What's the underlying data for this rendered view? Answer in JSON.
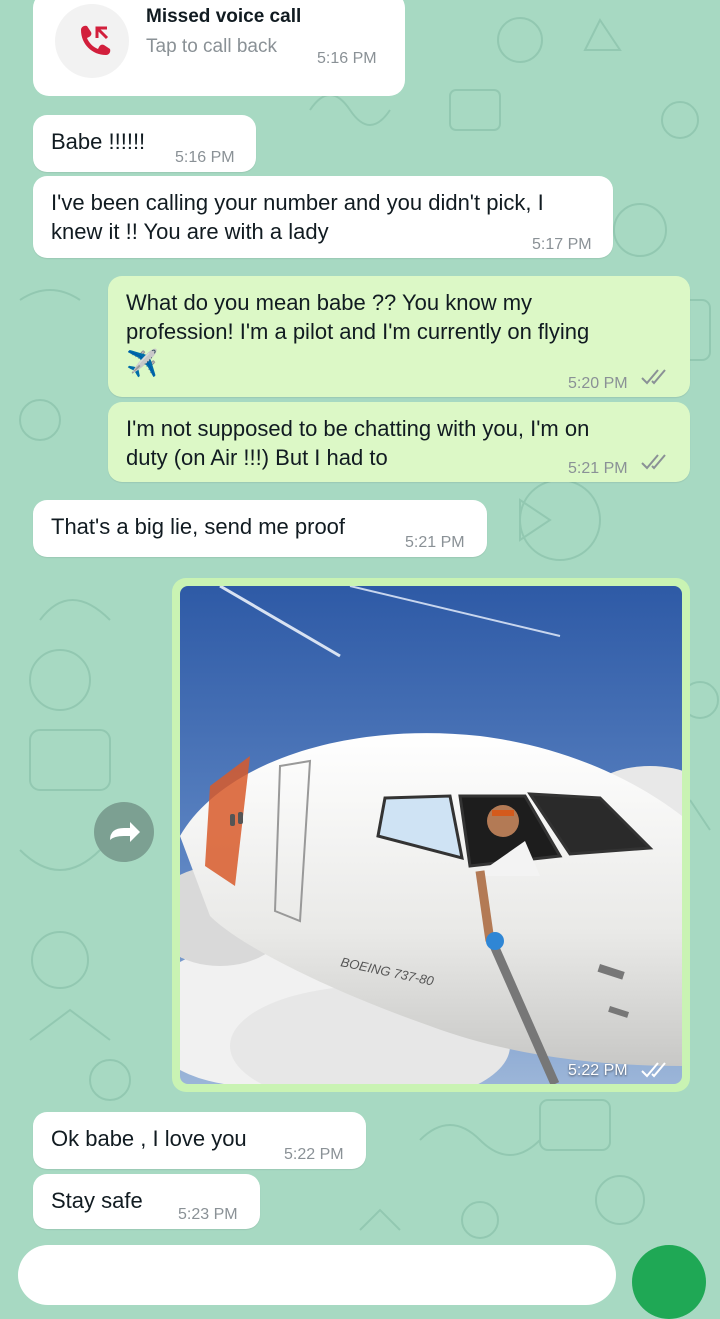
{
  "colors": {
    "wallpaper": "#a7d9c2",
    "incoming_bubble": "#ffffff",
    "outgoing_bubble": "#dcf8c6",
    "missed_call_red": "#d21f3c",
    "send_button": "#1fa855"
  },
  "missed_call": {
    "title": "Missed voice call",
    "subtitle": "Tap to call back",
    "time": "5:16 PM",
    "icon": "missed-call-icon"
  },
  "messages": [
    {
      "direction": "in",
      "text": "Babe !!!!!!",
      "time": "5:16 PM"
    },
    {
      "direction": "in",
      "text_line1": "I've been calling your number and you didn't pick,  I",
      "text_line2": "knew it !! You are with a lady",
      "time": "5:17 PM"
    },
    {
      "direction": "out",
      "text_line1": "What do you mean babe ?? You know my",
      "text_line2": "profession! I'm a pilot and I'm currently on flying",
      "emoji": "✈️",
      "time": "5:20 PM",
      "status": "read"
    },
    {
      "direction": "out",
      "text_line1": "I'm not supposed to be chatting with you,  I'm on",
      "text_line2": "duty (on Air !!!) But I had to",
      "time": "5:21 PM",
      "status": "read"
    },
    {
      "direction": "in",
      "text": "That's a big lie,  send me proof",
      "time": "5:21 PM"
    },
    {
      "direction": "out",
      "type": "image",
      "image_text": "BOEING 737-80",
      "time": "5:22 PM",
      "status": "read"
    },
    {
      "direction": "in",
      "text": "Ok babe , I love you",
      "time": "5:22 PM"
    },
    {
      "direction": "in",
      "text": "Stay safe",
      "time": "5:23 PM"
    }
  ],
  "icons": {
    "forward": "forward-arrow-icon",
    "read_receipt": "double-check-icon"
  }
}
